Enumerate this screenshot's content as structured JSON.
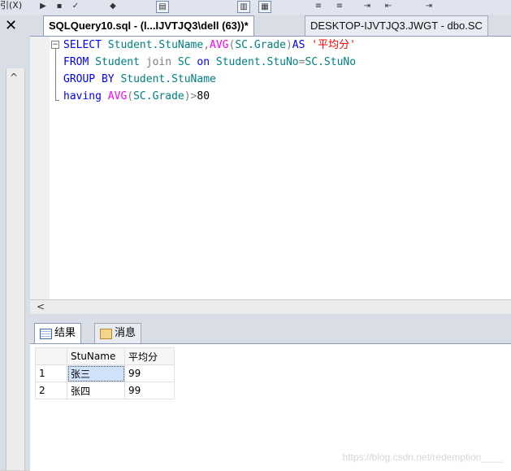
{
  "toolbar": {
    "label": "引(X)"
  },
  "tabs": [
    {
      "label": "SQLQuery10.sql - (l...IJVTJQ3\\dell (63))*"
    },
    {
      "label": "DESKTOP-IJVTJQ3.JWGT - dbo.SC"
    }
  ],
  "editor": {
    "line1": {
      "k1": "SELECT",
      "id1": "Student.StuName",
      "c1": ",",
      "f1": "AVG",
      "p1": "(",
      "id2": "SC.Grade",
      "p2": ")",
      "k2": "AS",
      "s1": "'平均分'"
    },
    "line2": {
      "k1": "FROM",
      "id1": "Student",
      "k2": "join",
      "id2": "SC",
      "k3": "on",
      "id3": "Student.StuNo",
      "op": "=",
      "id4": "SC.StuNo"
    },
    "line3": {
      "k1": "GROUP BY",
      "id1": "Student.StuName"
    },
    "line4": {
      "k1": "having",
      "f1": "AVG",
      "p1": "(",
      "id1": "SC.Grade",
      "p2": ")",
      "op": ">",
      "n1": "80"
    }
  },
  "result_tabs": {
    "results": "结果",
    "messages": "消息"
  },
  "grid": {
    "headers": [
      "StuName",
      "平均分"
    ],
    "rows": [
      {
        "num": "1",
        "name": "张三",
        "avg": "99"
      },
      {
        "num": "2",
        "name": "张四",
        "avg": "99"
      }
    ]
  },
  "watermark": "https://blog.csdn.net/redemption____"
}
